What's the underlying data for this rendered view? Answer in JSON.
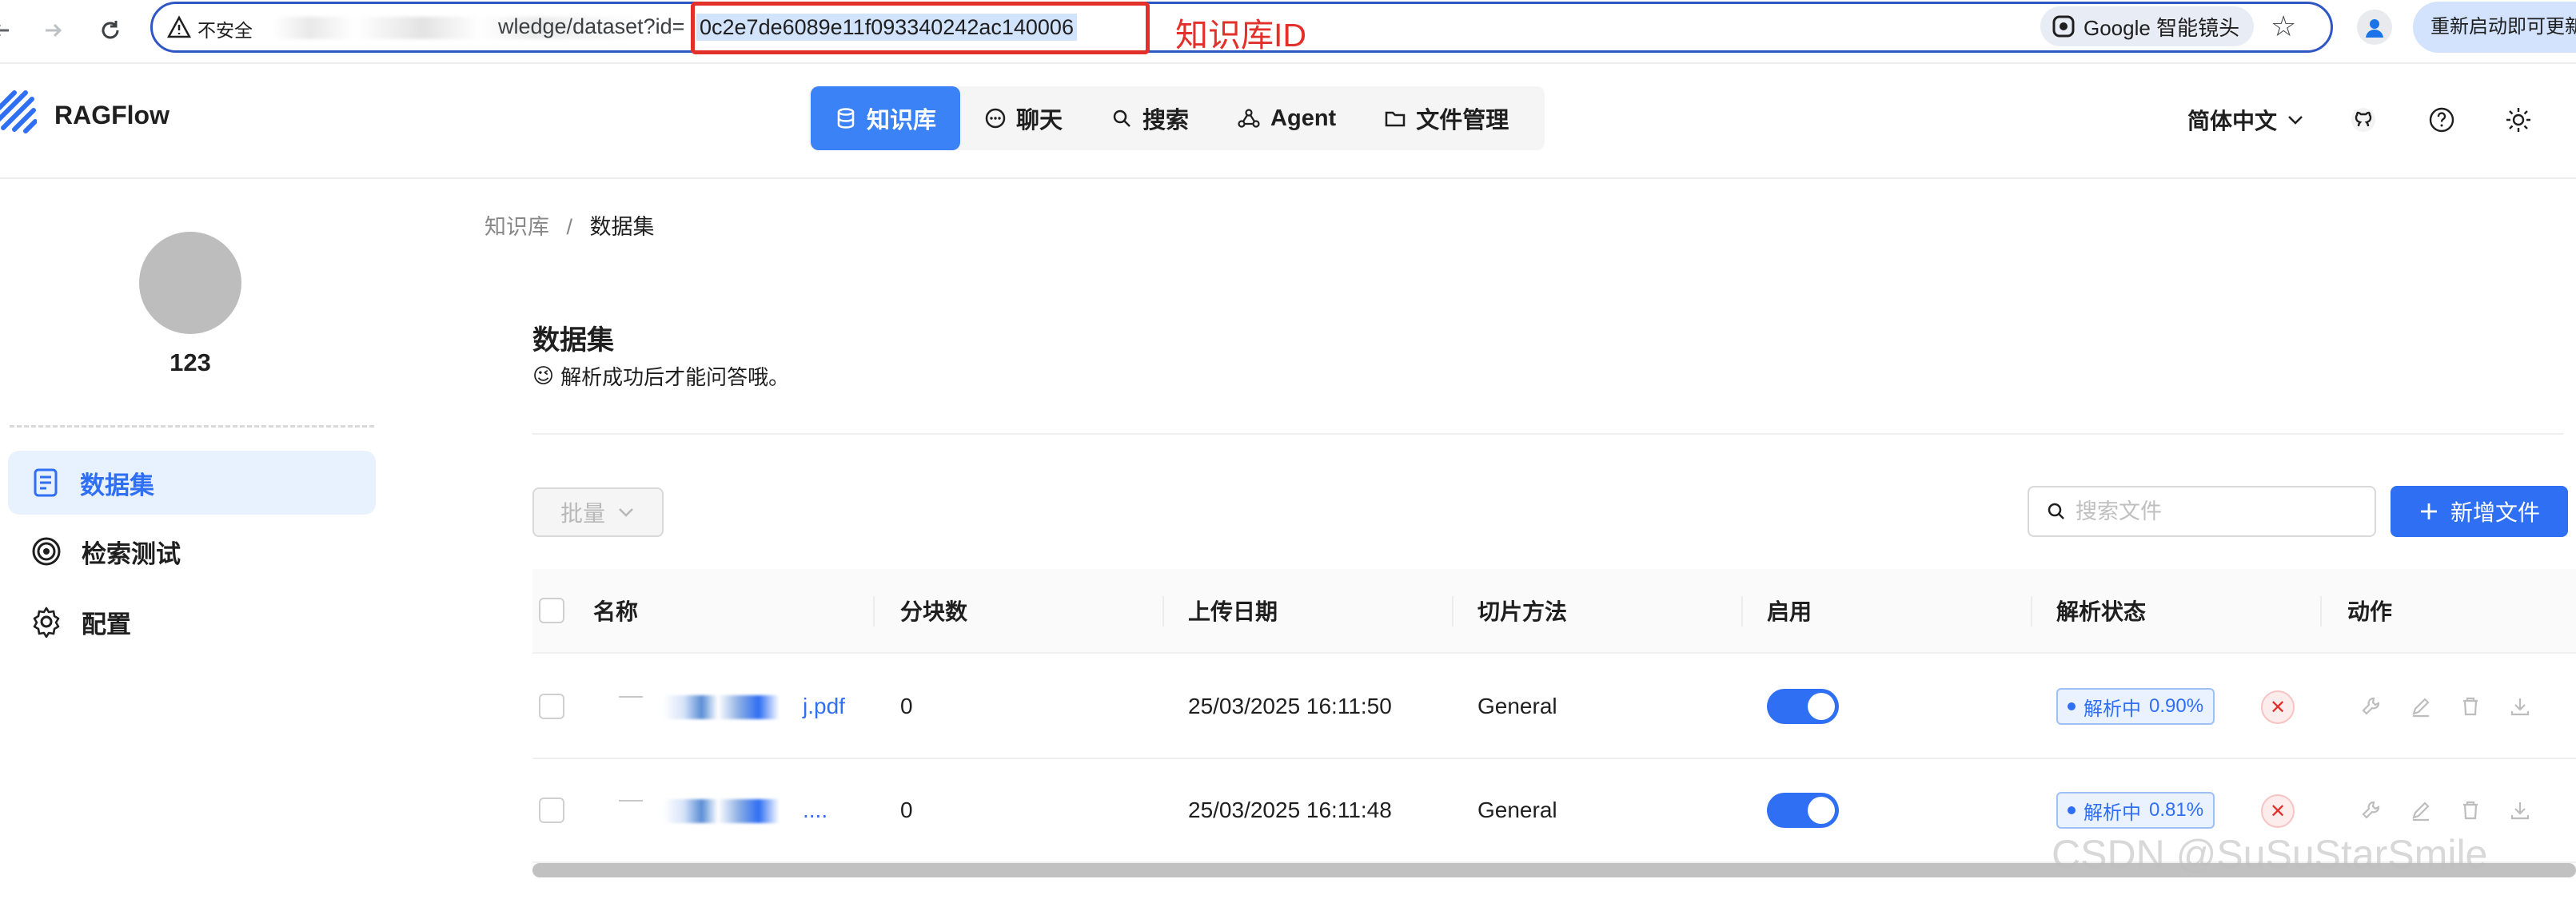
{
  "browser": {
    "back_icon": "back-arrow-icon",
    "forward_icon": "forward-arrow-icon",
    "reload_icon": "reload-icon",
    "insecure_label": "不安全",
    "url_visible": "wledge/dataset?id=",
    "url_id": "0c2e7de6089e11f093340242ac140006",
    "annotation": "知识库ID",
    "lens_label": "Google 智能镜头",
    "bookmark_icon": "star-icon",
    "profile_icon": "profile-icon",
    "relaunch_label": "重新启动即可更新"
  },
  "header": {
    "logo_text": "RAGFlow",
    "nav": [
      {
        "label": "知识库",
        "icon": "database-icon",
        "active": true
      },
      {
        "label": "聊天",
        "icon": "chat-icon",
        "active": false
      },
      {
        "label": "搜索",
        "icon": "search-icon",
        "active": false
      },
      {
        "label": "Agent",
        "icon": "agent-graph-icon",
        "active": false
      },
      {
        "label": "文件管理",
        "icon": "folder-icon",
        "active": false
      }
    ],
    "language": "简体中文",
    "icons": [
      "github-icon",
      "help-icon",
      "theme-sun-icon"
    ]
  },
  "sidebar": {
    "kb_name": "123",
    "items": [
      {
        "label": "数据集",
        "icon": "dataset-icon",
        "active": true
      },
      {
        "label": "检索测试",
        "icon": "target-icon",
        "active": false
      },
      {
        "label": "配置",
        "icon": "gear-icon",
        "active": false
      }
    ]
  },
  "main": {
    "breadcrumb": {
      "root": "知识库",
      "separator": "/",
      "current": "数据集"
    },
    "title": "数据集",
    "tip_emoji": "😉",
    "tip": "解析成功后才能问答哦。",
    "bulk_label": "批量",
    "search_placeholder": "搜索文件",
    "add_label": "新增文件",
    "table": {
      "columns": [
        "名称",
        "分块数",
        "上传日期",
        "切片方法",
        "启用",
        "解析状态",
        "动作"
      ],
      "rows": [
        {
          "name_suffix": "j.pdf",
          "chunks": "0",
          "date": "25/03/2025 16:11:50",
          "method": "General",
          "enabled": true,
          "status_label": "解析中",
          "progress": "0.90%"
        },
        {
          "name_suffix": "....",
          "chunks": "0",
          "date": "25/03/2025 16:11:48",
          "method": "General",
          "enabled": true,
          "status_label": "解析中",
          "progress": "0.81%"
        }
      ],
      "action_icons": [
        "wrench-icon",
        "edit-icon",
        "delete-icon",
        "download-icon"
      ]
    }
  },
  "watermark": "CSDN @SuSuStarSmile",
  "colors": {
    "accent": "#2f6ff3",
    "annotation": "#e3302a",
    "active_bg": "#e8f1fe"
  }
}
